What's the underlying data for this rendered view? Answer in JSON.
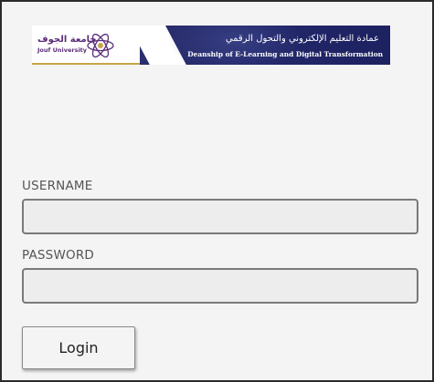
{
  "banner": {
    "university_name_ar": "جامعة الجوف",
    "university_name_en": "Jouf University",
    "deanship_name_ar": "عمادة التعليم الإلكتروني والتحول الرقمي",
    "deanship_name_en": "Deanship of E-Learning and Digital Transformation",
    "logo_icon": "atom-logo-icon",
    "colors": {
      "banner_bg": "#23286a",
      "logo_purple": "#5b2c7a",
      "accent_gold": "#c9a44a"
    }
  },
  "form": {
    "username_label": "USERNAME",
    "username_value": "",
    "password_label": "PASSWORD",
    "password_value": "",
    "login_label": "Login"
  }
}
